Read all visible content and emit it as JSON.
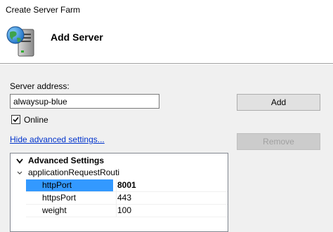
{
  "window": {
    "title": "Create Server Farm"
  },
  "banner": {
    "title": "Add Server",
    "icon": "server-globe-icon"
  },
  "form": {
    "server_address_label": "Server address:",
    "server_address_value": "alwaysup-blue",
    "online_label": "Online",
    "online_checked": true,
    "advanced_link": "Hide advanced settings..."
  },
  "buttons": {
    "add": "Add",
    "remove": "Remove"
  },
  "grid": {
    "header": "Advanced Settings",
    "group": "applicationRequestRouti",
    "properties": [
      {
        "name": "httpPort",
        "value": "8001",
        "selected": true,
        "bold": true
      },
      {
        "name": "httpsPort",
        "value": "443",
        "selected": false,
        "bold": false
      },
      {
        "name": "weight",
        "value": "100",
        "selected": false,
        "bold": false
      }
    ]
  },
  "colors": {
    "selection": "#3399ff",
    "link": "#0033cc",
    "background": "#f0f0f0"
  }
}
